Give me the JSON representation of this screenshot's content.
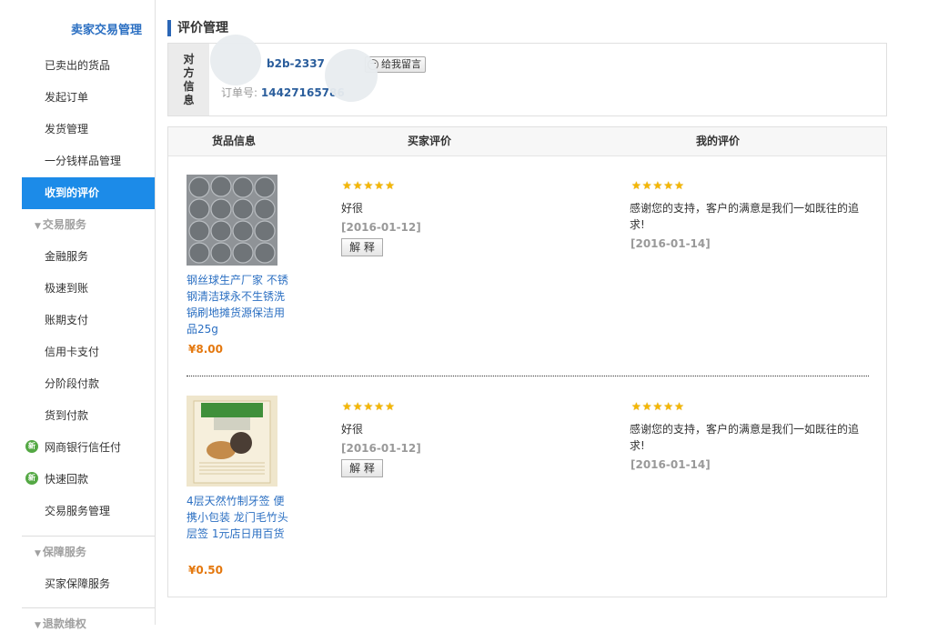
{
  "sidebar": {
    "title": "卖家交易管理",
    "items": [
      {
        "label": "已卖出的货品"
      },
      {
        "label": "发起订单"
      },
      {
        "label": "发货管理"
      },
      {
        "label": "一分钱样品管理"
      },
      {
        "label": "收到的评价",
        "active": true
      }
    ],
    "section_trade": "交易服务",
    "trade_items": [
      {
        "label": "金融服务"
      },
      {
        "label": "极速到账"
      },
      {
        "label": "账期支付"
      },
      {
        "label": "信用卡支付"
      },
      {
        "label": "分阶段付款"
      },
      {
        "label": "货到付款"
      },
      {
        "label": "网商银行信任付",
        "badge": "新"
      },
      {
        "label": "快速回款",
        "badge": "新"
      },
      {
        "label": "交易服务管理"
      }
    ],
    "section_guarantee": "保障服务",
    "guarantee_items": [
      {
        "label": "买家保障服务"
      }
    ],
    "section_refund": "退款维权"
  },
  "page": {
    "title": "评价管理",
    "party_label": "对方信息",
    "party_name": "b2b-2337",
    "message_button": "给我留言",
    "order_label": "订单号:",
    "order_number": "14427165786"
  },
  "table": {
    "headers": [
      "货品信息",
      "买家评价",
      "我的评价"
    ],
    "reviews": [
      {
        "product_name": "钢丝球生产厂家 不锈钢清洁球永不生锈洗锅刷地摊货源保洁用品25g",
        "price": "¥8.00",
        "buyer_stars": 5,
        "buyer_text": "好很",
        "buyer_date": "[2016-01-12]",
        "explain_button": "解 释",
        "my_stars": 5,
        "my_text": "感谢您的支持，客户的满意是我们一如既往的追求!",
        "my_date": "[2016-01-14]"
      },
      {
        "product_name": "4层天然竹制牙签 便携小包装 龙门毛竹头层签 1元店日用百货",
        "price": "¥0.50",
        "buyer_stars": 5,
        "buyer_text": "好很",
        "buyer_date": "[2016-01-12]",
        "explain_button": "解 释",
        "my_stars": 5,
        "my_text": "感谢您的支持，客户的满意是我们一如既往的追求!",
        "my_date": "[2016-01-14]"
      }
    ]
  },
  "colors": {
    "accent_blue": "#1c8be8",
    "link_blue": "#2b6fc2",
    "price_orange": "#e4780e",
    "star_gold": "#f5b700"
  },
  "icons": [
    "chevron-down-icon",
    "new-badge-icon",
    "message-face-icon",
    "star-icon"
  ]
}
